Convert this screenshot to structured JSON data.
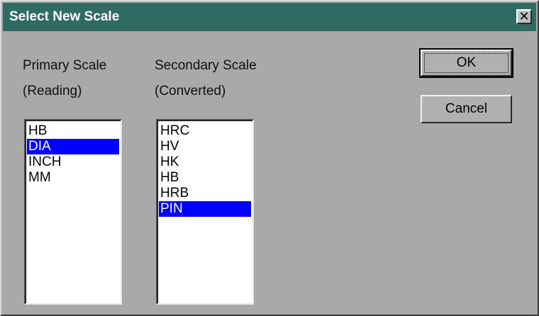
{
  "window": {
    "title": "Select New Scale",
    "close_glyph": "✕"
  },
  "primary": {
    "label_line1": "Primary Scale",
    "label_line2": "(Reading)",
    "items": [
      "HB",
      "DIA",
      "INCH",
      "MM"
    ],
    "selected": "DIA"
  },
  "secondary": {
    "label_line1": "Secondary Scale",
    "label_line2": "(Converted)",
    "items": [
      "HRC",
      "HV",
      "HK",
      "HB",
      "HRB",
      "PIN"
    ],
    "selected": "PIN"
  },
  "buttons": {
    "ok_label": "OK",
    "cancel_label": "Cancel"
  },
  "colors": {
    "title_bar": "#2f6b63",
    "selection": "#0000ff",
    "dialog_face": "#a9a9a9"
  }
}
